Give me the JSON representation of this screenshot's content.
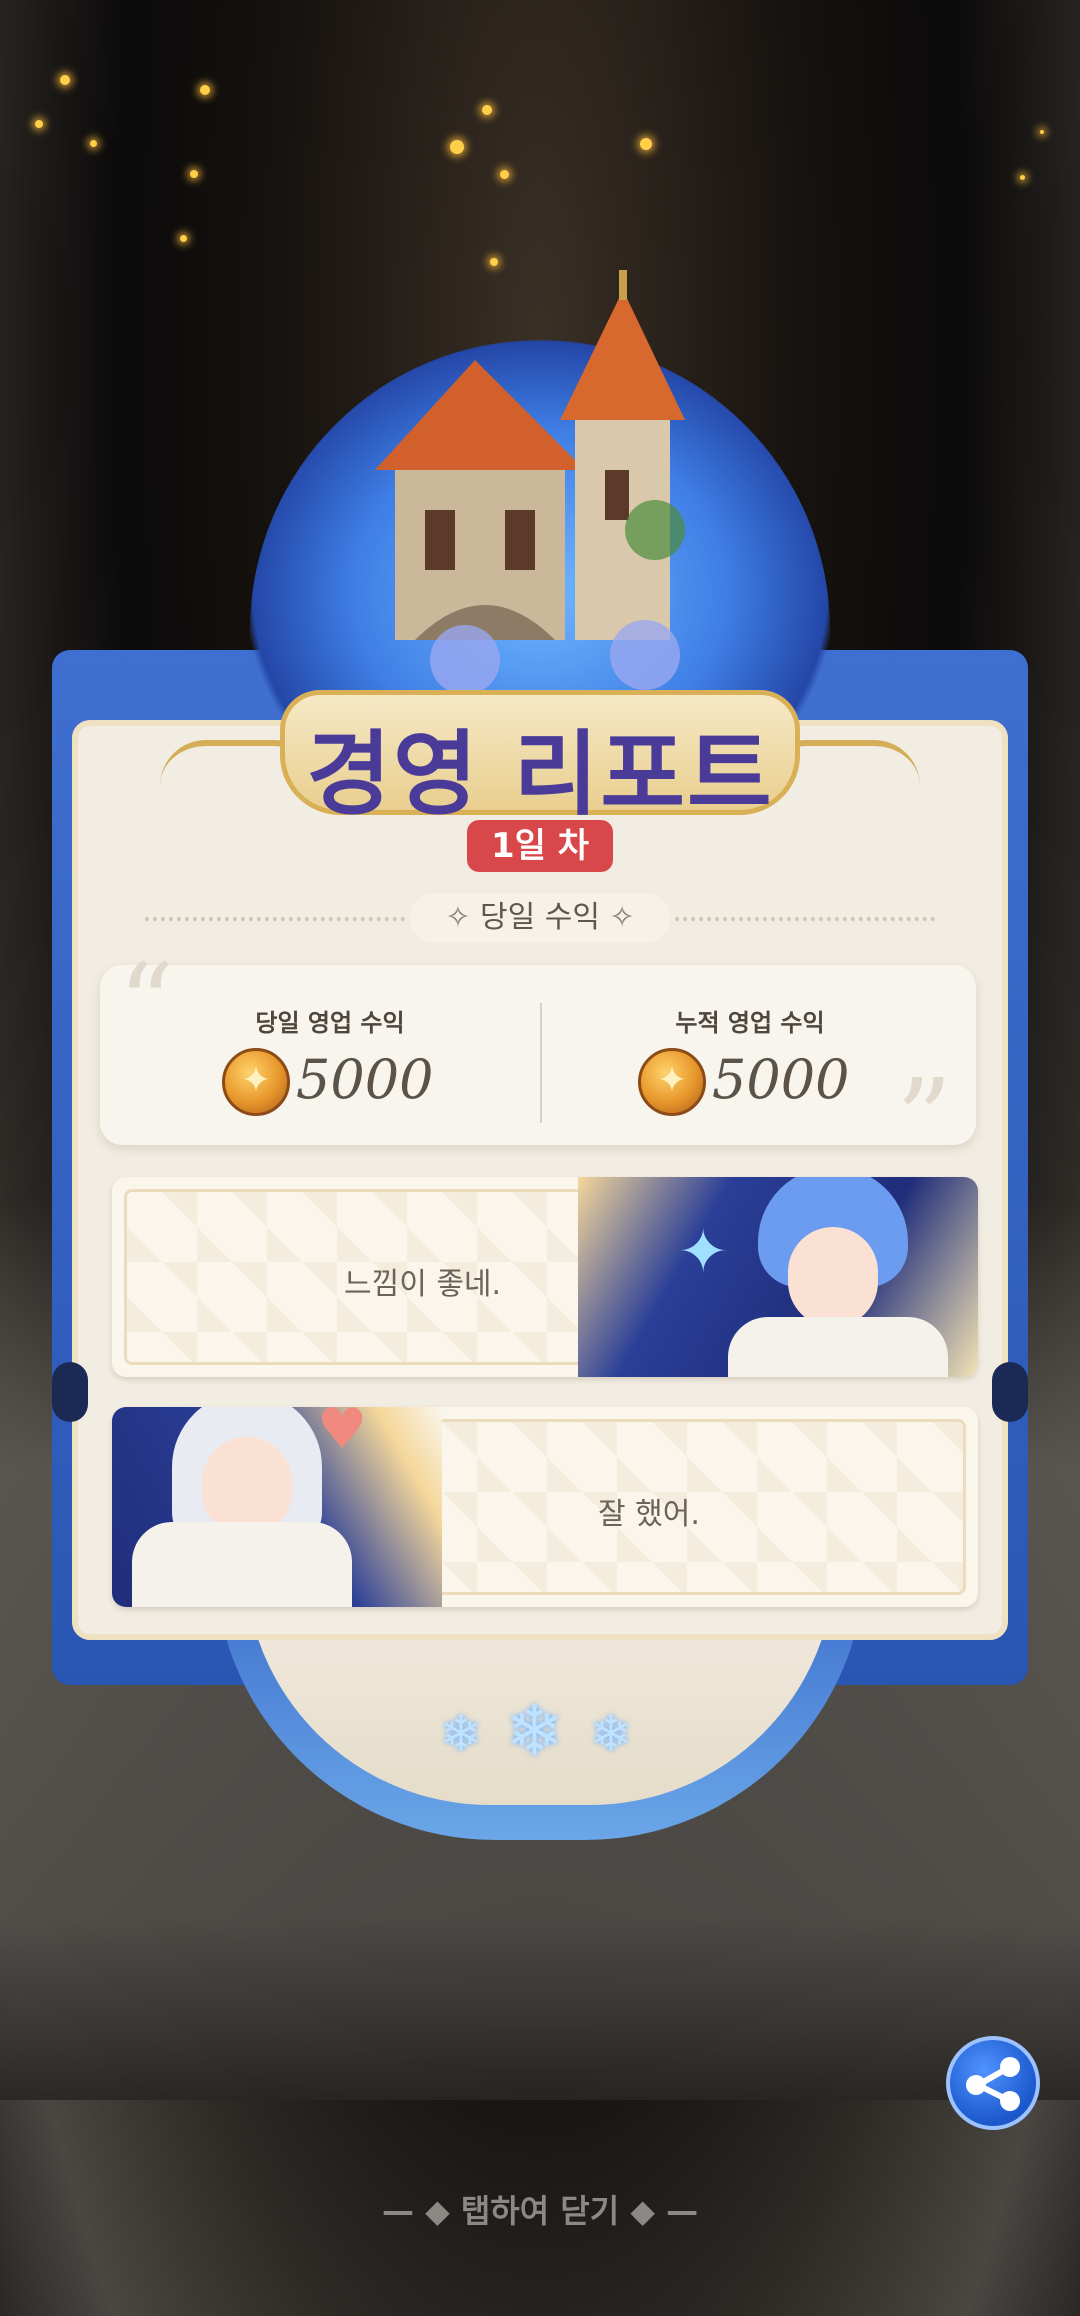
{
  "header": {
    "title": "경영 리포트",
    "day_badge": "1일 차"
  },
  "section": {
    "label": "당일 수익"
  },
  "revenue": {
    "daily_label": "당일 영업 수익",
    "daily_value": "5000",
    "total_label": "누적 영업 수익",
    "total_value": "5000"
  },
  "dialogs": [
    {
      "text": "느낌이 좋네."
    },
    {
      "text": "잘 했어."
    }
  ],
  "footer": {
    "close_hint": "탭하여 닫기"
  },
  "icons": {
    "coin": "coin-icon",
    "share": "share-icon"
  },
  "colors": {
    "title": "#4b3b99",
    "badge": "#d8474a",
    "frame": "#2a56b3"
  }
}
